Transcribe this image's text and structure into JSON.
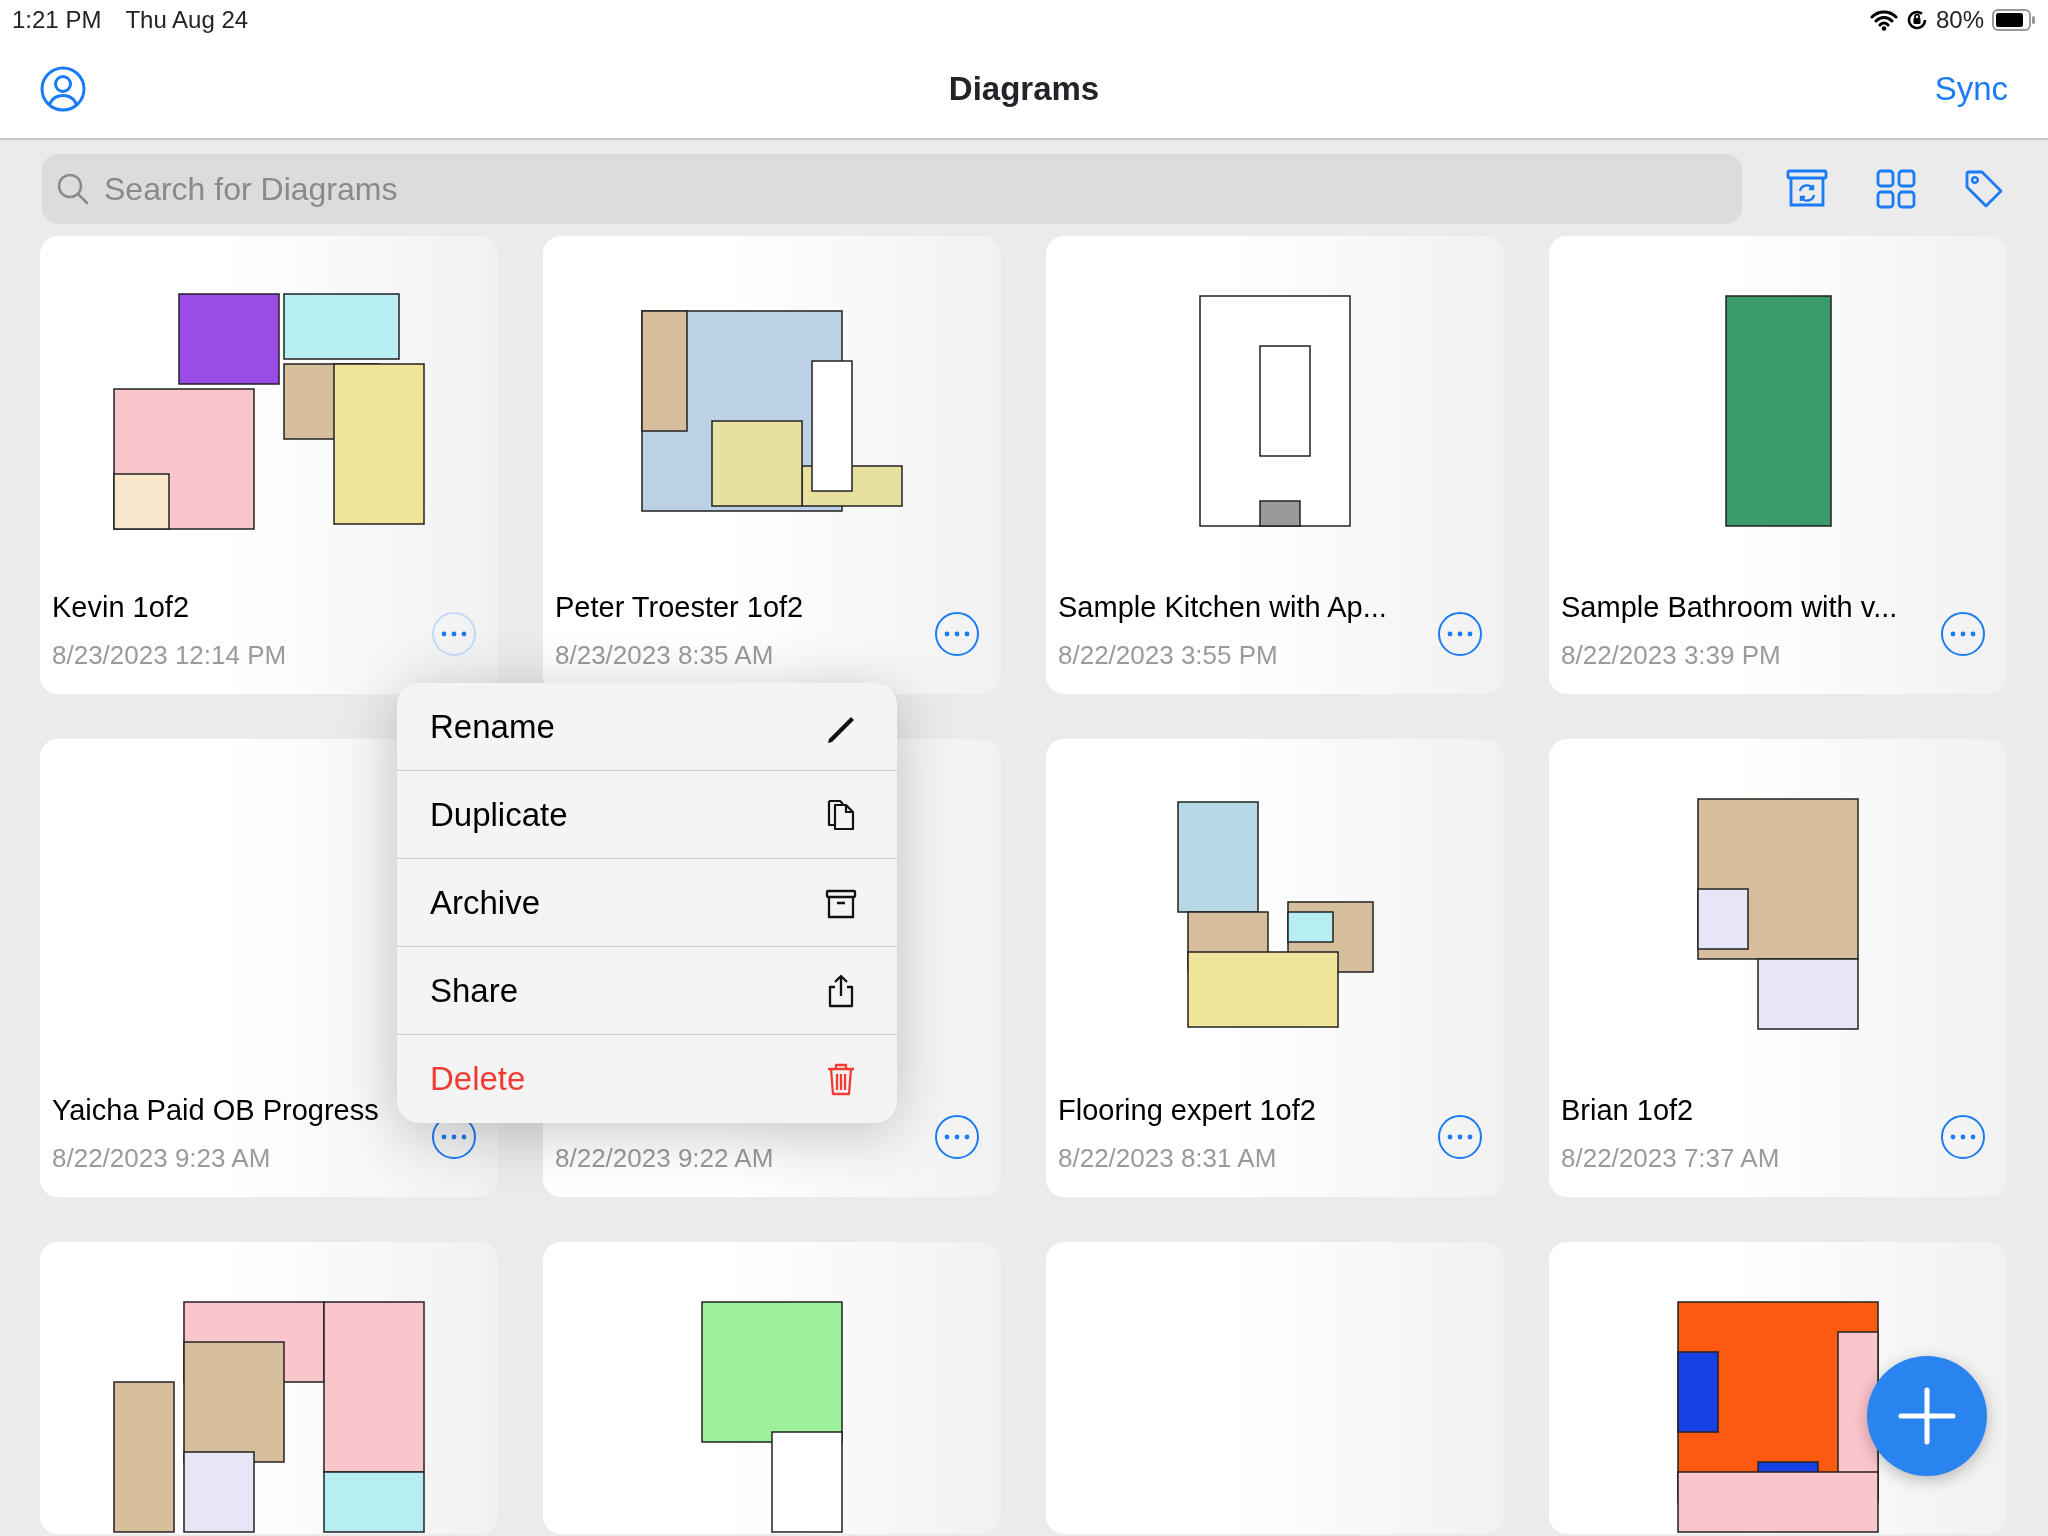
{
  "status_bar": {
    "time": "1:21 PM",
    "date": "Thu Aug 24",
    "battery": "80%"
  },
  "nav": {
    "title": "Diagrams",
    "sync": "Sync"
  },
  "search": {
    "placeholder": "Search for Diagrams"
  },
  "cards": [
    {
      "preview": true,
      "title": "Kevin 1of2",
      "date": "8/23/2023 12:14 PM",
      "menu_open": true
    },
    {
      "preview": true,
      "title": "Peter Troester 1of2",
      "date": "8/23/2023 8:35 AM",
      "menu_open": false
    },
    {
      "preview": true,
      "title": "Sample Kitchen with Ap...",
      "date": "8/22/2023 3:55 PM",
      "menu_open": false
    },
    {
      "preview": true,
      "title": "Sample Bathroom with v...",
      "date": "8/22/2023 3:39 PM",
      "menu_open": false
    },
    {
      "preview": false,
      "title": "Yaicha Paid OB Progress",
      "date": "8/22/2023 9:23 AM",
      "menu_open": false
    },
    {
      "preview": false,
      "date": "8/22/2023 9:22 AM",
      "menu_open": false
    },
    {
      "preview": true,
      "title": "Flooring expert 1of2",
      "date": "8/22/2023 8:31 AM",
      "menu_open": false
    },
    {
      "preview": true,
      "title": "Brian 1of2",
      "date": "8/22/2023 7:37 AM",
      "menu_open": false
    },
    {
      "preview": true
    },
    {
      "preview": true
    },
    {
      "preview": false
    },
    {
      "preview": true
    }
  ],
  "context_menu": {
    "items": [
      {
        "label": "Rename",
        "kind": "normal"
      },
      {
        "label": "Duplicate",
        "kind": "normal"
      },
      {
        "label": "Archive",
        "kind": "normal"
      },
      {
        "label": "Share",
        "kind": "normal"
      },
      {
        "label": "Delete",
        "kind": "destructive"
      }
    ]
  }
}
